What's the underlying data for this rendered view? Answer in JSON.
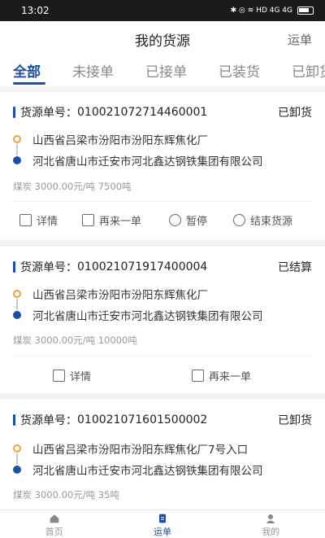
{
  "status_bar": {
    "time": "13:02",
    "icons": "✱ ◎ ≋ HD 4G 4G"
  },
  "header": {
    "title": "我的货源",
    "right_label": "运单"
  },
  "tabs": [
    {
      "label": "全部"
    },
    {
      "label": "未接单"
    },
    {
      "label": "已接单"
    },
    {
      "label": "已装货"
    },
    {
      "label": "已卸货"
    }
  ],
  "orders": [
    {
      "label": "货源单号：",
      "number": "010021072714460001",
      "status": "已卸货",
      "from": "山西省吕梁市汾阳市汾阳东辉焦化厂",
      "to": "河北省唐山市迁安市河北鑫达钢铁集团有限公司",
      "meta": "煤炭  3000.00元/吨  7500吨",
      "actions": [
        "详情",
        "再来一单",
        "暂停",
        "结束货源"
      ]
    },
    {
      "label": "货源单号：",
      "number": "010021071917400004",
      "status": "已结算",
      "from": "山西省吕梁市汾阳市汾阳东辉焦化厂",
      "to": "河北省唐山市迁安市河北鑫达钢铁集团有限公司",
      "meta": "煤炭  3000.00元/吨  10000吨",
      "actions": [
        "详情",
        "再来一单"
      ]
    },
    {
      "label": "货源单号：",
      "number": "010021071601500002",
      "status": "已卸货",
      "from": "山西省吕梁市汾阳市汾阳东辉焦化厂7号入口",
      "to": "河北省唐山市迁安市河北鑫达钢铁集团有限公司",
      "meta": "煤炭  3000.00元/吨  35吨"
    }
  ],
  "bottom_nav": [
    {
      "label": "首页"
    },
    {
      "label": "运单"
    },
    {
      "label": "我的"
    }
  ],
  "colors": {
    "accent": "#1d4fa3",
    "origin": "#f0a23a"
  }
}
